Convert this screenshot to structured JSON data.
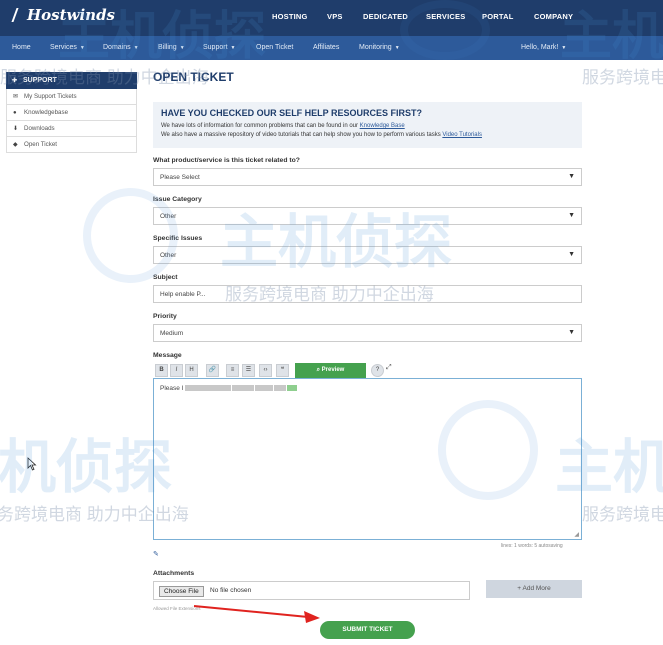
{
  "header": {
    "logo": "Hostwinds",
    "nav": [
      "HOSTING",
      "VPS",
      "DEDICATED",
      "SERVICES",
      "PORTAL",
      "COMPANY"
    ]
  },
  "subnav": {
    "items": [
      "Home",
      "Services",
      "Domains",
      "Billing",
      "Support",
      "Open Ticket",
      "Affiliates",
      "Monitoring"
    ],
    "user": "Hello, Mark!"
  },
  "sidebar": {
    "title": "SUPPORT",
    "items": [
      {
        "label": "My Support Tickets",
        "icon": "ticket-icon"
      },
      {
        "label": "Knowledgebase",
        "icon": "info-icon"
      },
      {
        "label": "Downloads",
        "icon": "download-icon"
      },
      {
        "label": "Open Ticket",
        "icon": "comment-icon"
      }
    ]
  },
  "page": {
    "title": "OPEN TICKET",
    "help": {
      "title": "HAVE YOU CHECKED OUR SELF HELP RESOURCES FIRST?",
      "line1": "We have lots of information for common problems that can be found in our ",
      "link1": "Knowledge Base",
      "line2": "We also have a massive repository of video tutorials that can help show you how to perform various tasks ",
      "link2": "Video Tutorials"
    }
  },
  "form": {
    "product_label": "What product/service is this ticket related to?",
    "product_value": "Please Select",
    "category_label": "Issue Category",
    "category_value": "Other",
    "specific_label": "Specific Issues",
    "specific_value": "Other",
    "subject_label": "Subject",
    "subject_value": "Help enable P...",
    "priority_label": "Priority",
    "priority_value": "Medium",
    "message_label": "Message",
    "toolbar": [
      "B",
      "I",
      "H",
      "🔗",
      "≡",
      "☰",
      "‹›",
      "❝"
    ],
    "preview_label": "Preview",
    "message_value": "Please I",
    "counter": "lines: 1  words: 5  autosaving",
    "attachments_label": "Attachments",
    "choose_file": "Choose File",
    "no_file": "No file chosen",
    "add_more": "+ Add More",
    "allowed": "Allowed File Extensions",
    "submit": "SUBMIT TICKET"
  },
  "watermark": {
    "brand": "主机侦探",
    "slogan": "服务跨境电商 助力中企出海"
  },
  "colors": {
    "primary": "#1f3d6b",
    "secondary": "#2d5a9a",
    "success": "#45a14e",
    "annotation_arrow": "#e0231f"
  }
}
